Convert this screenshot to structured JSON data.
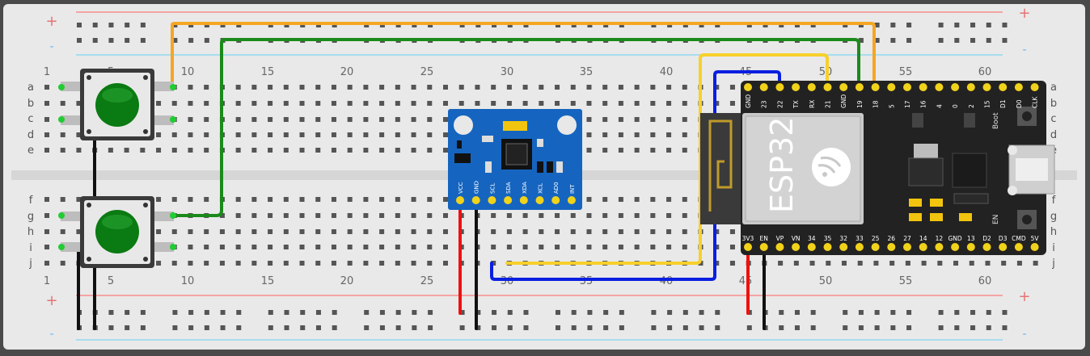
{
  "breadboard": {
    "plus_symbol": "+",
    "minus_symbol": "-",
    "column_labels": [
      "1",
      "5",
      "10",
      "15",
      "20",
      "25",
      "30",
      "35",
      "40",
      "45",
      "50",
      "55",
      "60"
    ],
    "rows_top": [
      "a",
      "b",
      "c",
      "d",
      "e"
    ],
    "rows_bottom": [
      "f",
      "g",
      "h",
      "i",
      "j"
    ],
    "colors": {
      "board": "#e9e9e9",
      "hole": "#555555",
      "rail_red": "#f4a4a4",
      "rail_blue": "#a9dcef",
      "trench": "#d8d8d8"
    }
  },
  "buttons": [
    {
      "name": "button-top",
      "color": "#0a7a12"
    },
    {
      "name": "button-bottom",
      "color": "#0a7a12"
    }
  ],
  "mpu": {
    "pins": [
      "VCC",
      "GND",
      "SCL",
      "SDA",
      "XDA",
      "XCL",
      "AD0",
      "INT"
    ],
    "color": "#1565c0"
  },
  "esp32": {
    "chip_label": "ESP32",
    "top_pins": [
      "GND",
      "23",
      "22",
      "TX",
      "RX",
      "21",
      "GND",
      "19",
      "18",
      "5",
      "17",
      "16",
      "4",
      "0",
      "2",
      "15",
      "D1",
      "D0",
      "CLK"
    ],
    "bottom_pins": [
      "3V3",
      "EN",
      "VP",
      "VN",
      "34",
      "35",
      "32",
      "33",
      "25",
      "26",
      "27",
      "14",
      "12",
      "GND",
      "13",
      "D2",
      "D3",
      "CMD",
      "5V"
    ],
    "boot_label": "Boot",
    "en_label": "EN",
    "color": "#222222"
  },
  "wires": {
    "orange": "#f5a623",
    "green": "#1b8a1b",
    "yellow": "#f7d02c",
    "blue": "#0a1fe0",
    "red": "#ee1111",
    "black": "#111111"
  }
}
